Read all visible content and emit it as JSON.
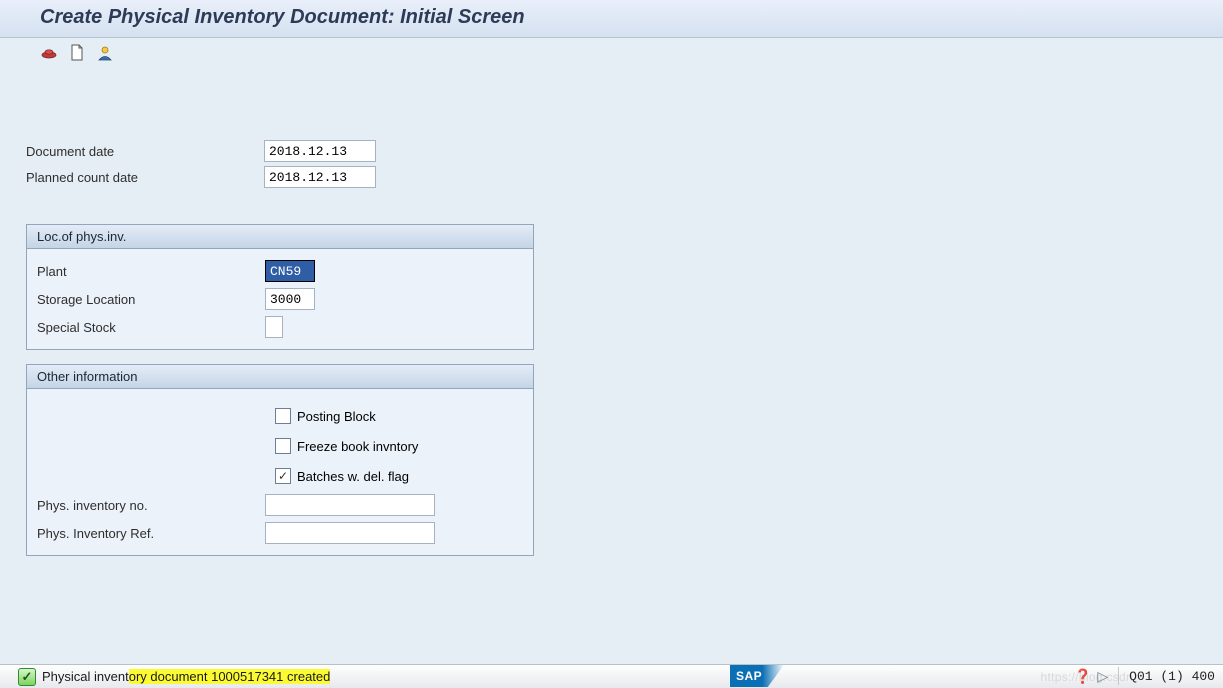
{
  "title": "Create Physical Inventory Document: Initial Screen",
  "toolbar": {
    "icons": [
      "hat-icon",
      "document-icon",
      "person-icon"
    ]
  },
  "dates": {
    "document_date_label": "Document date",
    "document_date": "2018.12.13",
    "planned_count_date_label": "Planned count date",
    "planned_count_date": "2018.12.13"
  },
  "loc_group": {
    "header": "Loc.of phys.inv.",
    "plant_label": "Plant",
    "plant": "CN59",
    "storage_location_label": "Storage Location",
    "storage_location": "3000",
    "special_stock_label": "Special Stock",
    "special_stock": ""
  },
  "other_group": {
    "header": "Other information",
    "posting_block_label": "Posting Block",
    "posting_block": false,
    "freeze_label": "Freeze book invntory",
    "freeze": false,
    "batches_label": "Batches w. del. flag",
    "batches": true,
    "phys_inv_no_label": "Phys. inventory no.",
    "phys_inv_no": "",
    "phys_inv_ref_label": "Phys. Inventory Ref.",
    "phys_inv_ref": ""
  },
  "status": {
    "message_pre": "Physical invent",
    "message_hl": "ory document 1000517341 created",
    "sap": "SAP",
    "watermark": "https://blog.csdn",
    "session": "Q01 (1) 400"
  }
}
